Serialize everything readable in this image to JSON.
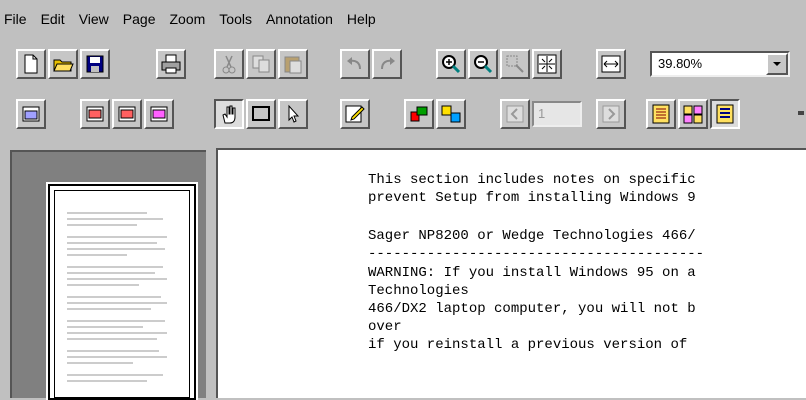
{
  "menubar": {
    "items": [
      {
        "label": "File"
      },
      {
        "label": "Edit"
      },
      {
        "label": "View"
      },
      {
        "label": "Page"
      },
      {
        "label": "Zoom"
      },
      {
        "label": "Tools"
      },
      {
        "label": "Annotation"
      },
      {
        "label": "Help"
      }
    ]
  },
  "toolbar1": {
    "buttons": [
      "new-icon",
      "open-icon",
      "save-icon",
      "print-icon",
      "cut-icon",
      "copy-icon",
      "paste-icon",
      "undo-icon",
      "redo-icon",
      "zoom-in-icon",
      "zoom-out-icon",
      "zoom-select-icon",
      "fit-page-icon",
      "fit-width-icon"
    ],
    "zoom_value": "39.80%"
  },
  "toolbar2": {
    "buttons": [
      "thumbnail-1-icon",
      "thumbnail-2-icon",
      "thumbnail-3-icon",
      "thumbnail-4-icon",
      "hand-tool-icon",
      "select-area-icon",
      "pointer-icon",
      "annotation-edit-icon",
      "color-icon",
      "rotate-icon",
      "previous-page-icon",
      "next-page-icon",
      "view-single-icon",
      "view-multi-icon",
      "view-text-icon"
    ],
    "page_number": "1"
  },
  "document": {
    "lines": [
      "This section includes notes on specific",
      "prevent Setup from installing Windows 9",
      "",
      "Sager NP8200 or Wedge Technologies 466/",
      "----------------------------------------",
      "WARNING: If you install Windows 95 on a",
      "Technologies",
      "466/DX2 laptop computer, you will not b",
      "over",
      "if you reinstall a previous version of"
    ]
  },
  "colors": {
    "chrome": "#c0c0c0",
    "thumb_pane": "#808080",
    "document_bg": "#ffffff"
  }
}
